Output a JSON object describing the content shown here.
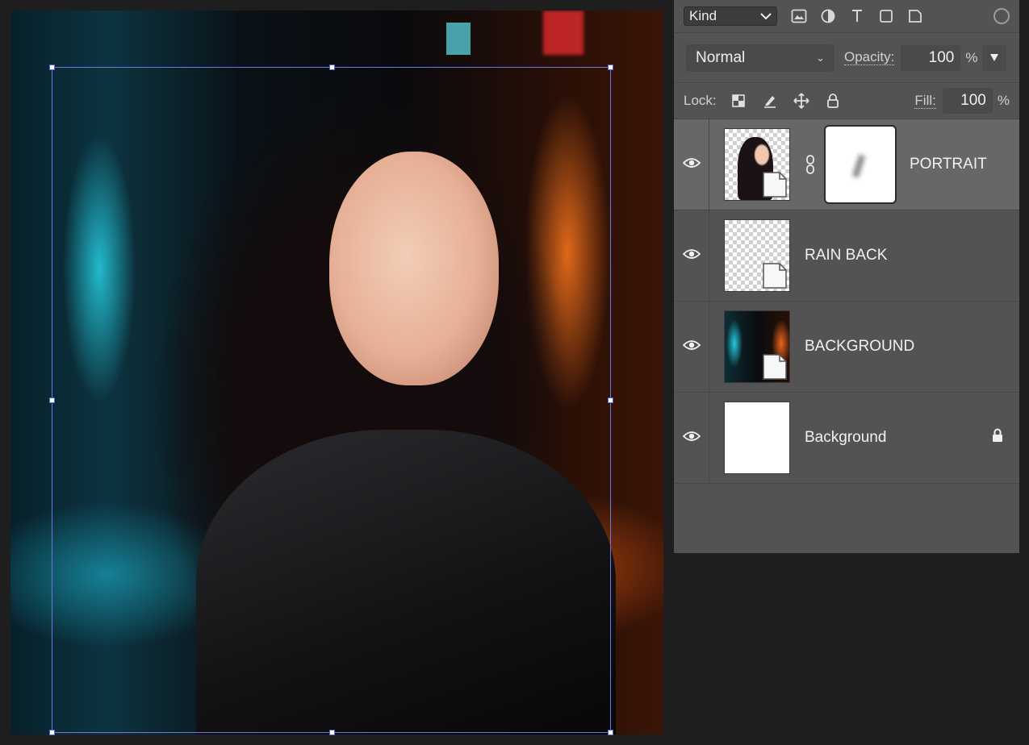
{
  "layers_panel": {
    "filter": {
      "kind_label": "Kind",
      "icons": [
        "image-filter-icon",
        "adjustment-filter-icon",
        "type-filter-icon",
        "shape-filter-icon",
        "smart-object-filter-icon"
      ]
    },
    "blend_mode": "Normal",
    "opacity_label": "Opacity:",
    "opacity_value": "100",
    "opacity_unit": "%",
    "lock_label": "Lock:",
    "fill_label": "Fill:",
    "fill_value": "100",
    "fill_unit": "%",
    "layers": [
      {
        "name": "PORTRAIT",
        "visible": true,
        "selected": true,
        "has_mask": true
      },
      {
        "name": "RAIN BACK",
        "visible": true,
        "selected": false
      },
      {
        "name": "BACKGROUND",
        "visible": true,
        "selected": false
      },
      {
        "name": "Background",
        "visible": true,
        "selected": false,
        "locked": true
      }
    ]
  },
  "colors": {
    "panel_bg": "#535353",
    "selected_row": "#676767",
    "transform_box": "#6b78e8"
  }
}
